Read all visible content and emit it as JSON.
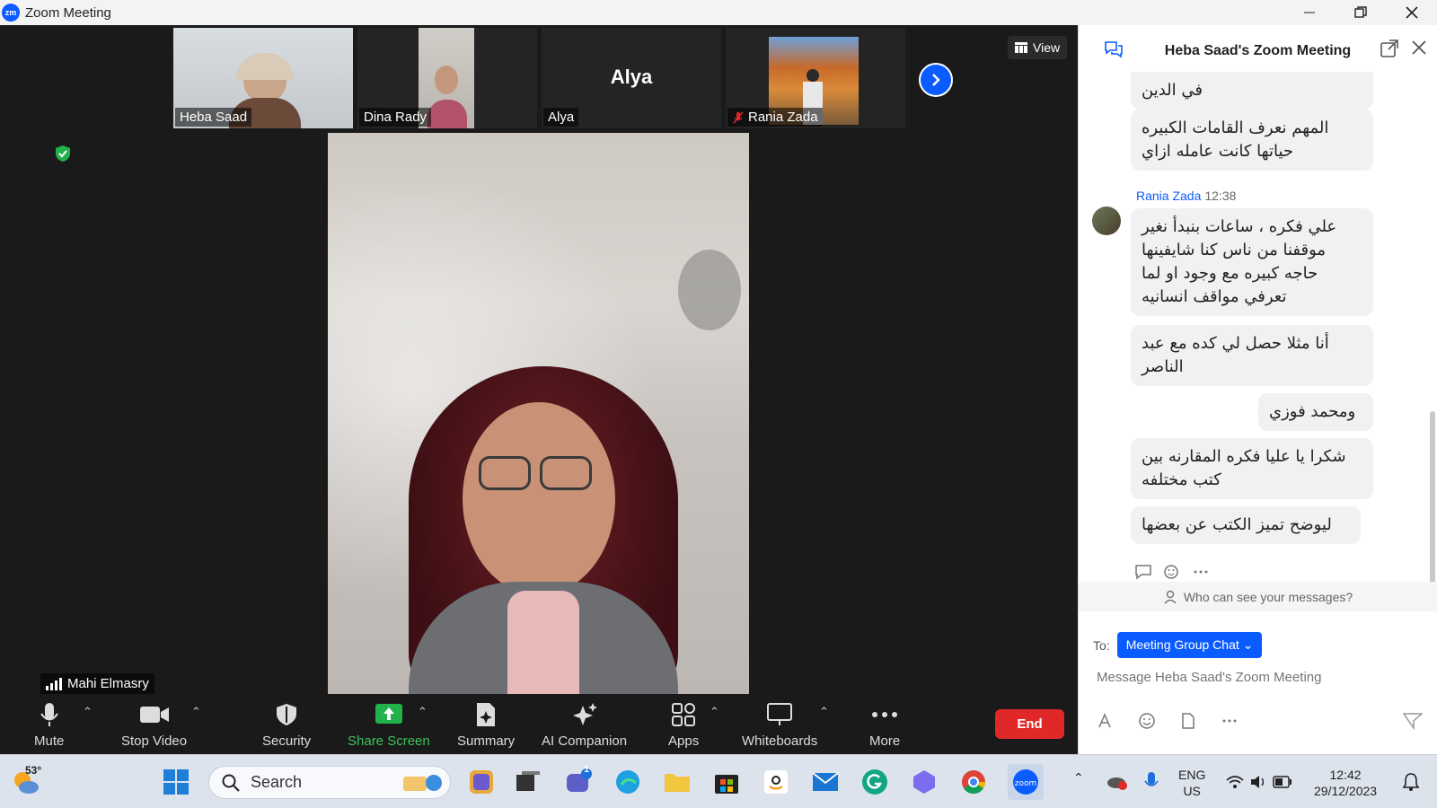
{
  "window": {
    "logo_text": "zm",
    "title": "Zoom Meeting"
  },
  "participants": [
    {
      "name": "Heba Saad",
      "muted": false
    },
    {
      "name": "Dina Rady",
      "muted": false
    },
    {
      "name": "Alya",
      "display": "Alya",
      "muted": false
    },
    {
      "name": "Rania Zada",
      "muted": true
    }
  ],
  "view_label": "View",
  "active_speaker": "Mahi Elmasry",
  "toolbar": {
    "mute": "Mute",
    "stop_video": "Stop Video",
    "security": "Security",
    "share_screen": "Share Screen",
    "summary": "Summary",
    "ai_companion": "AI Companion",
    "apps": "Apps",
    "whiteboards": "Whiteboards",
    "more": "More",
    "end": "End"
  },
  "chat": {
    "title": "Heba Saad's Zoom Meeting",
    "messages": [
      {
        "text": "في الدين"
      },
      {
        "text": "المهم نعرف القامات الكبيره حياتها كانت عامله ازاي"
      },
      {
        "text": "علي فكره ، ساعات بنبدأ نغير موقفنا من ناس كنا شايفينها حاجه كبيره مع وجود او لما تعرفي مواقف انسانيه"
      },
      {
        "text": "أنا مثلا حصل لي كده مع عبد الناصر"
      },
      {
        "text": "ومحمد فوزي"
      },
      {
        "text": "شكرا يا عليا فكره المقارنه بين كتب مختلفه"
      },
      {
        "text": "ليوضح تميز الكتب عن بعضها"
      }
    ],
    "sender": {
      "name": "Rania Zada",
      "time": "12:38"
    },
    "who_can_see": "Who can see your messages?",
    "to_label": "To:",
    "recipient": "Meeting Group Chat",
    "input_placeholder": "Message Heba Saad's Zoom Meeting"
  },
  "taskbar": {
    "weather_temp": "53°",
    "search_label": "Search",
    "chat_badge": "1",
    "lang_line1": "ENG",
    "lang_line2": "US",
    "time": "12:42",
    "date": "29/12/2023"
  },
  "colors": {
    "accent": "#0b5cff",
    "end": "#e02828",
    "share": "#22b24c"
  }
}
